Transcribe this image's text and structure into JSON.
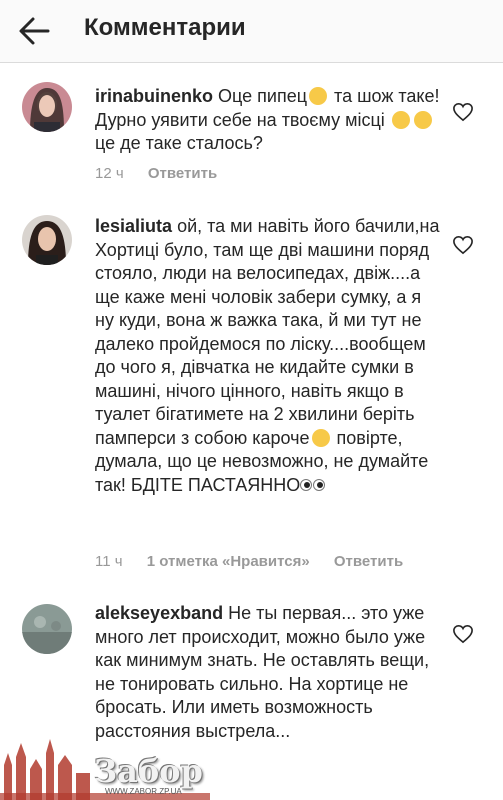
{
  "header": {
    "title": "Комментарии"
  },
  "comments": [
    {
      "username": "irinabuinenko",
      "text_parts": [
        "Оце пипец",
        " та шож таке! Дурно уявити себе на твоєму місці",
        " це де таке сталось?"
      ],
      "time": "12 ч",
      "reply": "Ответить"
    },
    {
      "username": "lesialiuta",
      "text_parts": [
        "ой, та ми навіть його бачили,на Хортиці було, там ще дві машини поряд стояло, люди на велосипедах, двіж....а ще каже мені чоловік забери сумку, а я ну куди, вона ж важка така, й ми тут не далеко пройдемося по ліску....вообщем до чого я, дівчатка не кидайте сумки в машині, нічого цінного, навіть якщо в туалет бігатимете на 2 хвилини беріть памперси з собою кароче",
        " повірте, думала, що це невозможно, не думайте так! БДІТЕ ПАСТАЯННО"
      ],
      "time": "11 ч",
      "likes": "1 отметка «Нравится»",
      "reply": "Ответить"
    },
    {
      "username": "alekseyexband",
      "text_parts": [
        "Не ты первая... это уже много лет происходит, можно было уже как минимум знать. Не оставлять вещи, не тонировать сильно. На хортице не бросать. Или иметь возможность расстояния выстрела..."
      ]
    }
  ],
  "icons": {
    "back": "arrow-left-icon",
    "like": "heart-outline-icon"
  },
  "watermark": {
    "brand": "Забор",
    "url": "WWW.ZABOR.ZP.UA"
  }
}
